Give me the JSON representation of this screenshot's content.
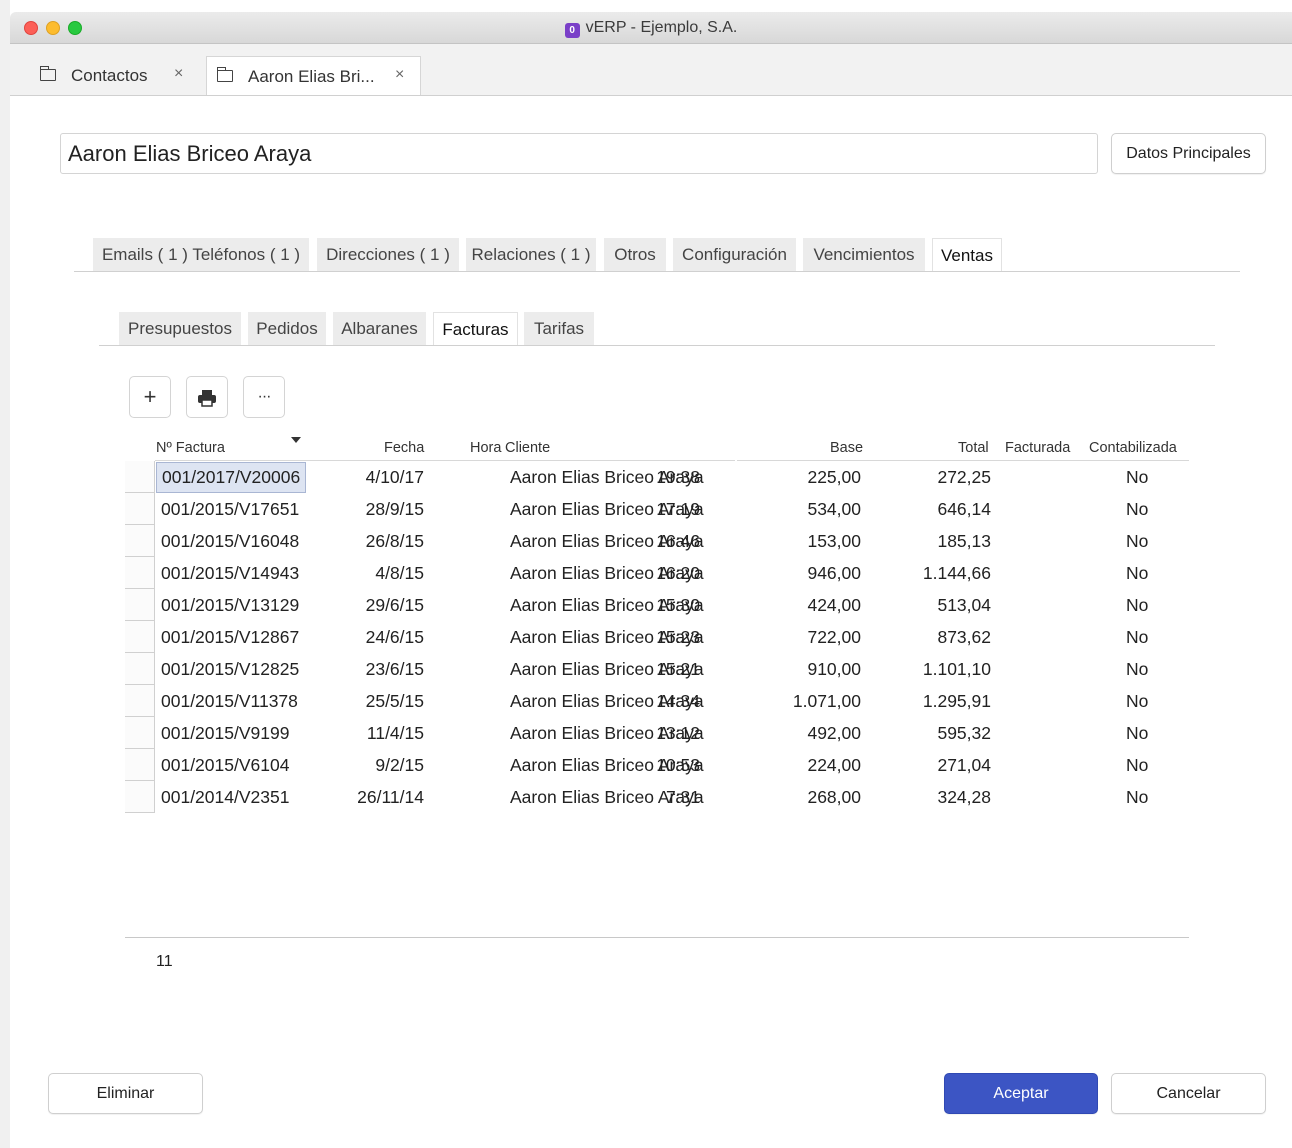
{
  "window": {
    "title": "vERP - Ejemplo, S.A.",
    "app_icon_glyph": "0"
  },
  "doc_tabs": [
    {
      "label": "Contactos",
      "close": "×"
    },
    {
      "label": "Aaron Elias Bri...",
      "close": "×"
    }
  ],
  "contact": {
    "name": "Aaron Elias Briceo Araya",
    "datos_button": "Datos Principales"
  },
  "section_tabs": [
    "Emails ( 1 ) Teléfonos ( 1 )",
    "Direcciones ( 1 )",
    "Relaciones ( 1 )",
    "Otros",
    "Configuración",
    "Vencimientos",
    "Ventas"
  ],
  "sub_tabs": [
    "Presupuestos",
    "Pedidos",
    "Albaranes",
    "Facturas",
    "Tarifas"
  ],
  "toolbar": {
    "add": "+",
    "more": "···"
  },
  "table": {
    "columns": {
      "num": "Nº Factura",
      "fecha": "Fecha",
      "hora": "Hora",
      "cliente": "Cliente",
      "base": "Base",
      "total": "Total",
      "facturada": "Facturada",
      "contabilizada": "Contabilizada"
    },
    "rows": [
      {
        "num": "001/2017/V20006",
        "fecha": "4/10/17",
        "hora": "19:38",
        "cliente": "Aaron Elias Briceo Araya",
        "base": "225,00",
        "total": "272,25",
        "cont": "No"
      },
      {
        "num": "001/2015/V17651",
        "fecha": "28/9/15",
        "hora": "17:19",
        "cliente": "Aaron Elias Briceo Araya",
        "base": "534,00",
        "total": "646,14",
        "cont": "No"
      },
      {
        "num": "001/2015/V16048",
        "fecha": "26/8/15",
        "hora": "16:46",
        "cliente": "Aaron Elias Briceo Araya",
        "base": "153,00",
        "total": "185,13",
        "cont": "No"
      },
      {
        "num": "001/2015/V14943",
        "fecha": "4/8/15",
        "hora": "16:20",
        "cliente": "Aaron Elias Briceo Araya",
        "base": "946,00",
        "total": "1.144,66",
        "cont": "No"
      },
      {
        "num": "001/2015/V13129",
        "fecha": "29/6/15",
        "hora": "15:30",
        "cliente": "Aaron Elias Briceo Araya",
        "base": "424,00",
        "total": "513,04",
        "cont": "No"
      },
      {
        "num": "001/2015/V12867",
        "fecha": "24/6/15",
        "hora": "15:23",
        "cliente": "Aaron Elias Briceo Araya",
        "base": "722,00",
        "total": "873,62",
        "cont": "No"
      },
      {
        "num": "001/2015/V12825",
        "fecha": "23/6/15",
        "hora": "15:21",
        "cliente": "Aaron Elias Briceo Araya",
        "base": "910,00",
        "total": "1.101,10",
        "cont": "No"
      },
      {
        "num": "001/2015/V11378",
        "fecha": "25/5/15",
        "hora": "14:34",
        "cliente": "Aaron Elias Briceo Araya",
        "base": "1.071,00",
        "total": "1.295,91",
        "cont": "No"
      },
      {
        "num": "001/2015/V9199",
        "fecha": "11/4/15",
        "hora": "13:12",
        "cliente": "Aaron Elias Briceo Araya",
        "base": "492,00",
        "total": "595,32",
        "cont": "No"
      },
      {
        "num": "001/2015/V6104",
        "fecha": "9/2/15",
        "hora": "10:53",
        "cliente": "Aaron Elias Briceo Araya",
        "base": "224,00",
        "total": "271,04",
        "cont": "No"
      },
      {
        "num": "001/2014/V2351",
        "fecha": "26/11/14",
        "hora": "7:31",
        "cliente": "Aaron Elias Briceo Araya",
        "base": "268,00",
        "total": "324,28",
        "cont": "No"
      }
    ],
    "count": "11"
  },
  "footer": {
    "eliminar": "Eliminar",
    "aceptar": "Aceptar",
    "cancelar": "Cancelar"
  },
  "colors": {
    "accent": "#3c55c4",
    "selection": "#dde4f2"
  }
}
